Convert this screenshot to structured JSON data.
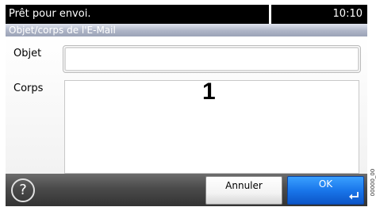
{
  "status_bar": {
    "message": "Prêt pour envoi.",
    "time": "10:10"
  },
  "title_bar": {
    "title": "Objet/corps de l'E-Mail"
  },
  "form": {
    "subject_label": "Objet",
    "subject_value": "",
    "body_label": "Corps",
    "body_value": ""
  },
  "callout": {
    "number": "1"
  },
  "bottom_bar": {
    "help_icon": "help-circle-icon",
    "help_glyph": "?",
    "cancel_label": "Annuler",
    "ok_label": "OK",
    "enter_icon": "enter-arrow-icon"
  },
  "side_code": "00000_00",
  "colors": {
    "status_bar_bg": "#000000",
    "ok_button": "#1976ea",
    "bottom_bar_bg": "#4a4a4a"
  }
}
